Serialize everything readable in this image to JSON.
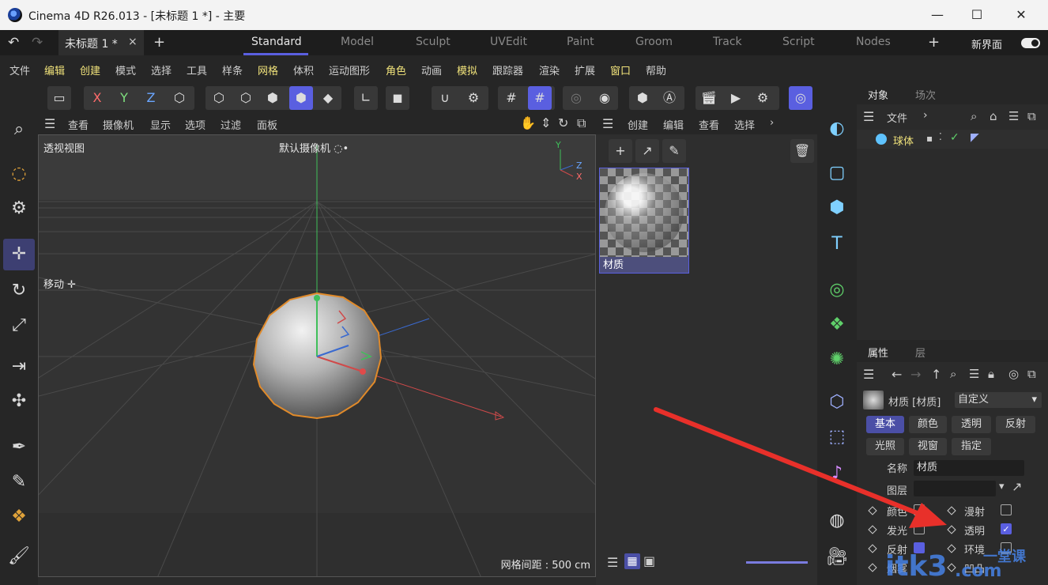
{
  "window": {
    "title": "Cinema 4D R26.013 - [未标题 1 *] - 主要",
    "minimize": "—",
    "maximize": "☐",
    "close": "✕"
  },
  "tabs": {
    "document": "未标题 1 *",
    "layouts": [
      "Standard",
      "Model",
      "Sculpt",
      "UVEdit",
      "Paint",
      "Groom",
      "Track",
      "Script",
      "Nodes"
    ],
    "active_layout": "Standard",
    "new_ui": "新界面",
    "add": "+"
  },
  "menu": [
    "文件",
    "编辑",
    "创建",
    "模式",
    "选择",
    "工具",
    "样条",
    "网格",
    "体积",
    "运动图形",
    "角色",
    "动画",
    "模拟",
    "跟踪器",
    "渲染",
    "扩展",
    "窗口",
    "帮助"
  ],
  "viewport": {
    "menu": [
      "查看",
      "摄像机",
      "显示",
      "选项",
      "过滤",
      "面板"
    ],
    "view_label": "透视视图",
    "camera_label": "默认摄像机 ◌•",
    "move_label": "移动 ✛",
    "grid_info": "网格间距 : 500 cm",
    "axis": {
      "y": "Y",
      "z": "Z",
      "x": "X"
    }
  },
  "material_manager": {
    "menu": [
      "创建",
      "编辑",
      "查看",
      "选择"
    ],
    "material_name": "材质"
  },
  "object_panel": {
    "tabs": [
      "对象",
      "场次"
    ],
    "menu": "文件",
    "object_name": "球体"
  },
  "attributes_panel": {
    "tabs": [
      "属性",
      "层"
    ],
    "header_label": "材质 [材质]",
    "mode": "自定义",
    "chips_row1": [
      "基本",
      "颜色",
      "透明",
      "反射"
    ],
    "chips_row2": [
      "光照",
      "视窗",
      "指定"
    ],
    "name_label": "名称",
    "name_value": "材质",
    "layer_label": "图层",
    "channels_left": [
      "颜色",
      "发光",
      "反射",
      "烟雾"
    ],
    "channels_right": [
      "漫射",
      "透明",
      "环境",
      "凹凸"
    ],
    "transparent_checked": true
  },
  "watermark": {
    "brand": "itk3",
    "domain": ".com",
    "tag": "一堂课"
  },
  "colors": {
    "accent": "#5a5fe0",
    "arrow": "#e8302a",
    "sphere_outline": "#e08a2a"
  }
}
